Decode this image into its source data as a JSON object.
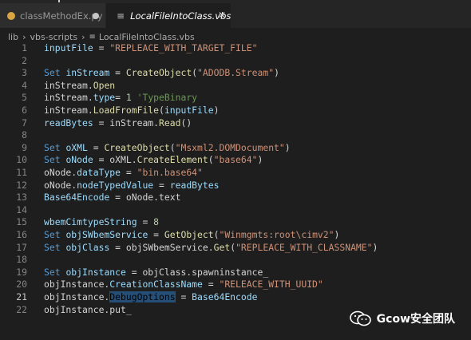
{
  "tabs": [
    {
      "label": "classMethodEx.py",
      "icon": "python-icon",
      "state": "modified"
    },
    {
      "label": "LocalFileIntoClass.vbs",
      "icon": "vbs-icon",
      "state": "active"
    }
  ],
  "breadcrumb": {
    "parts": [
      "lib",
      "vbs-scripts",
      "LocalFileIntoClass.vbs"
    ]
  },
  "editor": {
    "current_line": 21,
    "lines": [
      {
        "n": "1",
        "tokens": [
          [
            "var",
            "inputFile"
          ],
          [
            "default",
            " = "
          ],
          [
            "string",
            "\"REPLEACE_WITH_TARGET_FILE\""
          ]
        ]
      },
      {
        "n": "2",
        "tokens": []
      },
      {
        "n": "3",
        "tokens": [
          [
            "keyword",
            "Set"
          ],
          [
            "default",
            " "
          ],
          [
            "var",
            "inStream"
          ],
          [
            "default",
            " = "
          ],
          [
            "func",
            "CreateObject"
          ],
          [
            "default",
            "("
          ],
          [
            "string",
            "\"ADODB.Stream\""
          ],
          [
            "default",
            ")"
          ]
        ]
      },
      {
        "n": "4",
        "tokens": [
          [
            "default",
            "inStream."
          ],
          [
            "func",
            "Open"
          ]
        ]
      },
      {
        "n": "5",
        "tokens": [
          [
            "default",
            "inStream."
          ],
          [
            "var",
            "type"
          ],
          [
            "default",
            "= "
          ],
          [
            "number",
            "1"
          ],
          [
            "default",
            " "
          ],
          [
            "comment",
            "'TypeBinary"
          ]
        ]
      },
      {
        "n": "6",
        "tokens": [
          [
            "default",
            "inStream."
          ],
          [
            "func",
            "LoadFromFile"
          ],
          [
            "default",
            "("
          ],
          [
            "var",
            "inputFile"
          ],
          [
            "default",
            ")"
          ]
        ]
      },
      {
        "n": "7",
        "tokens": [
          [
            "var",
            "readBytes"
          ],
          [
            "default",
            " = inStream."
          ],
          [
            "func",
            "Read"
          ],
          [
            "default",
            "()"
          ]
        ]
      },
      {
        "n": "8",
        "tokens": []
      },
      {
        "n": "9",
        "tokens": [
          [
            "keyword",
            "Set"
          ],
          [
            "default",
            " "
          ],
          [
            "var",
            "oXML"
          ],
          [
            "default",
            " = "
          ],
          [
            "func",
            "CreateObject"
          ],
          [
            "default",
            "("
          ],
          [
            "string",
            "\"Msxml2.DOMDocument\""
          ],
          [
            "default",
            ")"
          ]
        ]
      },
      {
        "n": "10",
        "tokens": [
          [
            "keyword",
            "Set"
          ],
          [
            "default",
            " "
          ],
          [
            "var",
            "oNode"
          ],
          [
            "default",
            " = oXML."
          ],
          [
            "func",
            "CreateElement"
          ],
          [
            "default",
            "("
          ],
          [
            "string",
            "\"base64\""
          ],
          [
            "default",
            ")"
          ]
        ]
      },
      {
        "n": "11",
        "tokens": [
          [
            "default",
            "oNode."
          ],
          [
            "var",
            "dataType"
          ],
          [
            "default",
            " = "
          ],
          [
            "string",
            "\"bin.base64\""
          ]
        ]
      },
      {
        "n": "12",
        "tokens": [
          [
            "default",
            "oNode."
          ],
          [
            "var",
            "nodeTypedValue"
          ],
          [
            "default",
            " = "
          ],
          [
            "var",
            "readBytes"
          ]
        ]
      },
      {
        "n": "13",
        "tokens": [
          [
            "var",
            "Base64Encode"
          ],
          [
            "default",
            " = oNode.text"
          ]
        ]
      },
      {
        "n": "14",
        "tokens": []
      },
      {
        "n": "15",
        "tokens": [
          [
            "var",
            "wbemCimtypeString"
          ],
          [
            "default",
            " = "
          ],
          [
            "number",
            "8"
          ]
        ]
      },
      {
        "n": "16",
        "tokens": [
          [
            "keyword",
            "Set"
          ],
          [
            "default",
            " "
          ],
          [
            "var",
            "objSWbemService"
          ],
          [
            "default",
            " = "
          ],
          [
            "func",
            "GetObject"
          ],
          [
            "default",
            "("
          ],
          [
            "string",
            "\"Winmgmts:root\\cimv2\""
          ],
          [
            "default",
            ")"
          ]
        ]
      },
      {
        "n": "17",
        "tokens": [
          [
            "keyword",
            "Set"
          ],
          [
            "default",
            " "
          ],
          [
            "var",
            "objClass"
          ],
          [
            "default",
            " = objSWbemService."
          ],
          [
            "func",
            "Get"
          ],
          [
            "default",
            "("
          ],
          [
            "string",
            "\"REPLEACE_WITH_CLASSNAME\""
          ],
          [
            "default",
            ")"
          ]
        ]
      },
      {
        "n": "18",
        "tokens": []
      },
      {
        "n": "19",
        "tokens": [
          [
            "keyword",
            "Set"
          ],
          [
            "default",
            " "
          ],
          [
            "var",
            "objInstance"
          ],
          [
            "default",
            " = objClass.spawninstance_"
          ]
        ]
      },
      {
        "n": "20",
        "tokens": [
          [
            "default",
            "objInstance."
          ],
          [
            "var",
            "CreationClassName"
          ],
          [
            "default",
            " = "
          ],
          [
            "string",
            "\"RELEACE_WITH_UUID\""
          ]
        ]
      },
      {
        "n": "21",
        "tokens": [
          [
            "default",
            "objInstance."
          ],
          [
            "sel",
            "DebugOptions"
          ],
          [
            "default",
            " = "
          ],
          [
            "var",
            "Base64Encode"
          ]
        ]
      },
      {
        "n": "22",
        "tokens": [
          [
            "default",
            "objInstance.put_"
          ]
        ]
      }
    ]
  },
  "watermark": {
    "text": "Gcow安全团队",
    "icon": "wechat-icon"
  },
  "colors": {
    "background": "#1e1e1e",
    "selection": "#264f78",
    "keyword": "#569cd6",
    "string": "#ce9178",
    "function": "#dcdcaa",
    "variable": "#9cdcfe"
  }
}
